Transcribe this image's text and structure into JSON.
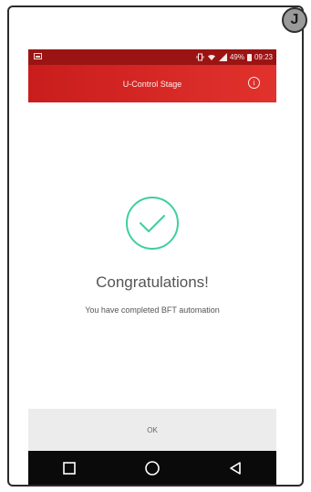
{
  "annotation": {
    "letter": "J"
  },
  "status_bar": {
    "battery_percent": "49%",
    "time": "09:23"
  },
  "toolbar": {
    "title": "U-Control Stage",
    "info_icon": "info-circle-icon"
  },
  "content": {
    "icon": "check-circle-icon",
    "headline": "Congratulations!",
    "message": "You have completed BFT automation"
  },
  "footer": {
    "ok_label": "OK"
  },
  "nav": {
    "recents": "square-icon",
    "home": "circle-icon",
    "back": "triangle-back-icon"
  },
  "colors": {
    "status_bar": "#9b1414",
    "toolbar": "#d8282a",
    "check_accent": "#3fcf9c",
    "nav_bar": "#0a0a0a",
    "ok_bar": "#ececec"
  }
}
